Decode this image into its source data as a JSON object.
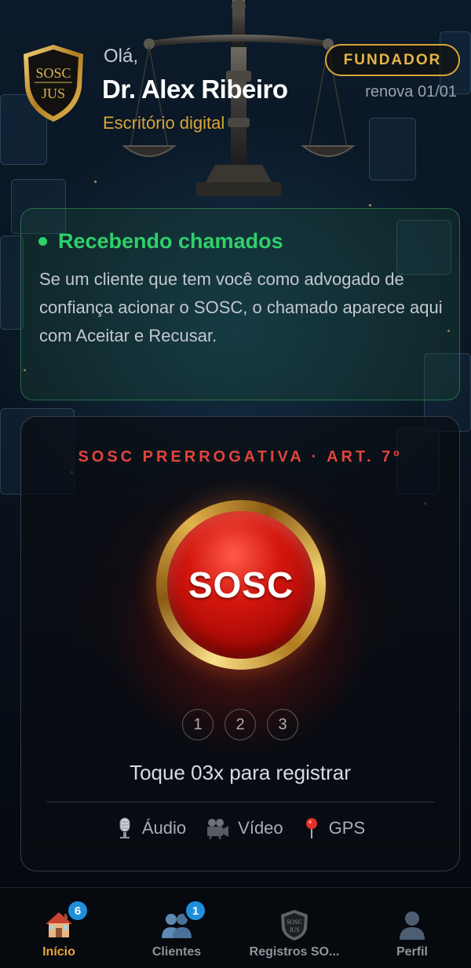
{
  "header": {
    "greeting": "Olá,",
    "user_name": "Dr. Alex Ribeiro",
    "office": "Escritório digital",
    "plan_badge": "FUNDADOR",
    "renewal": "renova 01/01",
    "logo_text_line1": "SOSC",
    "logo_text_line2": "JUS"
  },
  "receiving": {
    "status_title": "Recebendo chamados",
    "description": "Se um cliente que tem você como advogado de confiança acionar o SOSC, o chamado aparece aqui com Aceitar e Recusar."
  },
  "sos": {
    "heading": "SOSC PRERROGATIVA · ART. 7º",
    "button_label": "SOSC",
    "steps": [
      "1",
      "2",
      "3"
    ],
    "tap_hint": "Toque 03x para registrar",
    "features": [
      {
        "icon": "microphone-icon",
        "label": "Áudio"
      },
      {
        "icon": "video-camera-icon",
        "label": "Vídeo"
      },
      {
        "icon": "pin-icon",
        "label": "GPS"
      }
    ]
  },
  "nav": {
    "items": [
      {
        "icon": "house-icon",
        "label": "Início",
        "badge": "6",
        "active": true
      },
      {
        "icon": "users-icon",
        "label": "Clientes",
        "badge": "1",
        "active": false
      },
      {
        "icon": "shield-logo-icon",
        "label": "Registros SO...",
        "badge": "",
        "active": false
      },
      {
        "icon": "user-icon",
        "label": "Perfil",
        "badge": "",
        "active": false
      }
    ]
  },
  "colors": {
    "accent_gold": "#d7a637",
    "status_green": "#2ed06a",
    "alert_red": "#e0453b",
    "sos_red": "#d4160e",
    "badge_blue": "#1f8fdc",
    "nav_active": "#e9a53a"
  }
}
